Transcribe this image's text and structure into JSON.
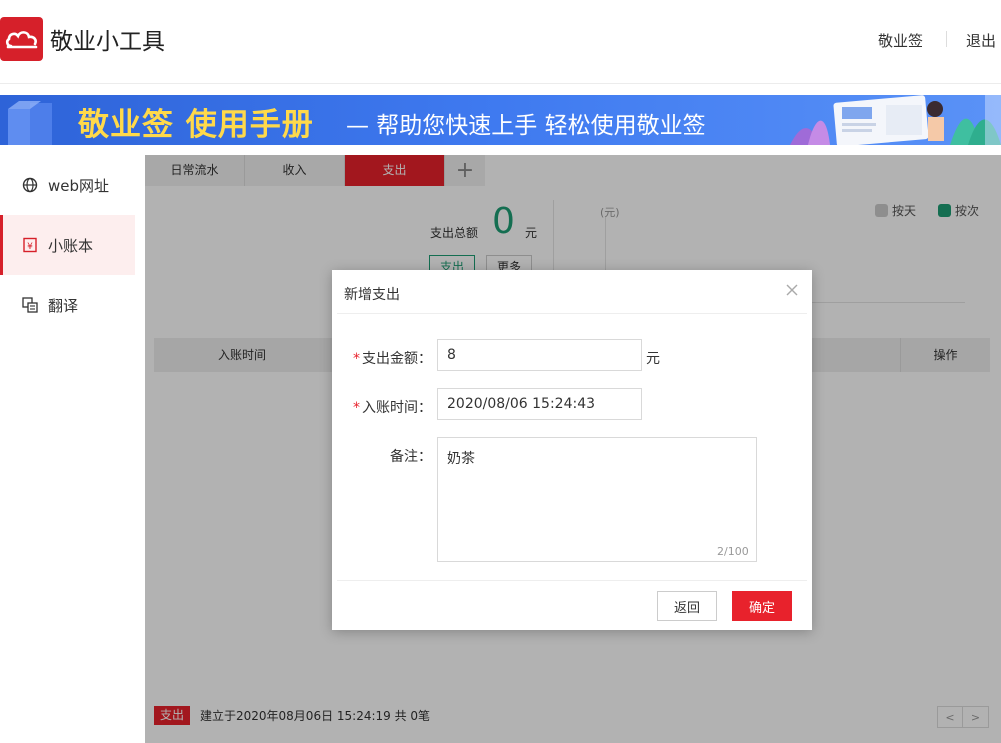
{
  "app": {
    "title": "敬业小工具"
  },
  "header": {
    "link_jingyeqian": "敬业签",
    "link_logout": "退出"
  },
  "banner": {
    "main": "敬业签 使用手册",
    "sub": "— 帮助您快速上手  轻松使用敬业签"
  },
  "sidebar": {
    "items": [
      {
        "label": "web网址",
        "icon": "globe-icon"
      },
      {
        "label": "小账本",
        "icon": "ledger-icon",
        "active": true
      },
      {
        "label": "翻译",
        "icon": "translate-icon"
      }
    ]
  },
  "tabs": [
    {
      "label": "日常流水"
    },
    {
      "label": "收入"
    },
    {
      "label": "支出",
      "active": true
    }
  ],
  "summary": {
    "label": "支出总额",
    "value": "0",
    "unit": "元",
    "btn_expense": "支出",
    "btn_more": "更多"
  },
  "chart": {
    "unit_label": "(元)",
    "legend_day": "按天",
    "legend_count": "按次",
    "legend_day_color": "#cccccc",
    "legend_count_color": "#1e9e74"
  },
  "table": {
    "col_time": "入账时间",
    "col_action": "操作"
  },
  "footer": {
    "badge": "支出",
    "created_text": "建立于2020年08月06日 15:24:19  共 0笔",
    "prev": "<",
    "next": ">"
  },
  "dialog": {
    "title": "新增支出",
    "amount_label": "支出金额：",
    "amount_value": "8",
    "amount_unit": "元",
    "time_label": "入账时间：",
    "time_value": "2020/08/06 15:24:43",
    "note_label": "备注：",
    "note_value": "奶茶",
    "note_counter": "2/100",
    "back_label": "返回",
    "ok_label": "确定"
  },
  "colors": {
    "brand_red": "#d6202a",
    "accent_green": "#1e9e74",
    "banner_blue": "#3f7af0",
    "banner_yellow": "#ffd94a"
  }
}
